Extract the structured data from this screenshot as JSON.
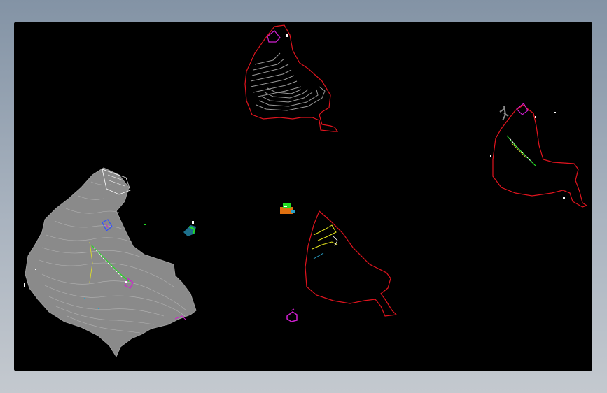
{
  "drawing": {
    "background_color": "#000000",
    "page_background": "#9aa6b3",
    "colors": {
      "boundary": "#e0141e",
      "contour": "#8a8a8a",
      "contour_light": "#bfbfbf",
      "magenta": "#d020d0",
      "green": "#22dd22",
      "yellow": "#e6e61e",
      "cyan": "#2aa0c8",
      "blue": "#3050ff",
      "white": "#ffffff",
      "orange": "#e07010"
    }
  }
}
